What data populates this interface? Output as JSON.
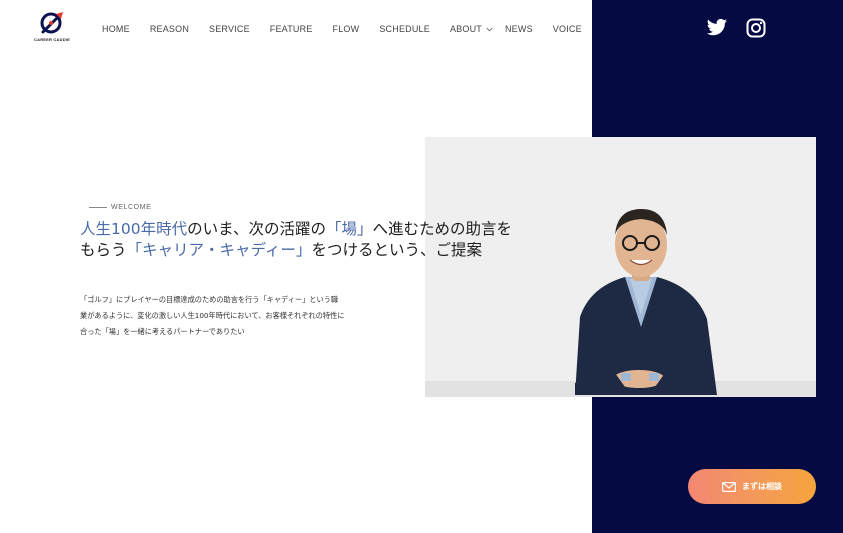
{
  "header": {
    "logo_text": "CAREER CADDIE",
    "nav": [
      {
        "label": "HOME"
      },
      {
        "label": "REASON"
      },
      {
        "label": "SERVICE"
      },
      {
        "label": "FEATURE"
      },
      {
        "label": "FLOW"
      },
      {
        "label": "SCHEDULE"
      },
      {
        "label": "ABOUT"
      },
      {
        "label": "NEWS"
      },
      {
        "label": "VOICE"
      }
    ],
    "social": [
      "twitter-icon",
      "instagram-icon"
    ]
  },
  "hero": {
    "eyebrow": "WELCOME",
    "headline": {
      "part1": "人生100年時代",
      "part2": "のいま、次の活躍の",
      "part3": "「場」",
      "part4": "へ進むための助言をもらう",
      "part5": "「キャリア・キャディー」",
      "part6": "をつけるという、ご提案"
    },
    "body": {
      "line1": "「ゴルフ」にプレイヤーの目標達成のための助言を行う「キャディー」という職",
      "line2": "業があるように、変化の激しい人生100年時代において、お客様それぞれの特性に",
      "line3": "合った「場」を一緒に考えるパートナーでありたい"
    }
  },
  "cta": {
    "label": "まずは相談",
    "icon": "mail-icon"
  },
  "colors": {
    "navy": "#050a42",
    "accent_blue": "#4a6aa8",
    "cta_gradient_start": "#f28773",
    "cta_gradient_end": "#f4a43c"
  }
}
